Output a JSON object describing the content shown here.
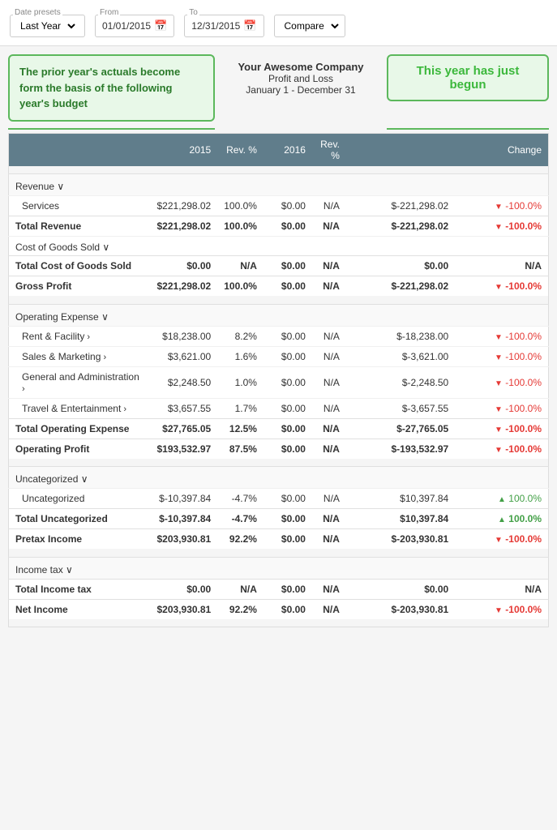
{
  "header": {
    "date_preset_label": "Date presets",
    "date_preset_value": "Last Year",
    "from_label": "From",
    "from_value": "01/01/2015",
    "to_label": "To",
    "to_value": "12/31/2015",
    "compare_label": "Compare"
  },
  "callout_left": "The prior year's actuals become form the basis of the following year's budget",
  "callout_right": "This year has just begun",
  "company": {
    "name": "Your Awesome Company",
    "report": "Profit and Loss",
    "date_range": "January 1 - December 31"
  },
  "columns": {
    "year1": "2015",
    "rev1": "Rev. %",
    "year2": "2016",
    "rev2": "Rev. %",
    "change": "Change"
  },
  "sections": {
    "revenue": {
      "label": "Revenue ∨",
      "rows": [
        {
          "name": "Services",
          "v2015": "$221,298.02",
          "rev1": "100.0%",
          "v2016": "$0.00",
          "rev2": "N/A",
          "change": "$-221,298.02",
          "arrow": "down",
          "chgpct": "-100.0%"
        }
      ],
      "total": {
        "name": "Total Revenue",
        "v2015": "$221,298.02",
        "rev1": "100.0%",
        "v2016": "$0.00",
        "rev2": "N/A",
        "change": "$-221,298.02",
        "arrow": "down",
        "chgpct": "-100.0%"
      }
    },
    "cogs": {
      "label": "Cost of Goods Sold ∨",
      "rows": [],
      "total": {
        "name": "Total Cost of Goods Sold",
        "v2015": "$0.00",
        "rev1": "N/A",
        "v2016": "$0.00",
        "rev2": "N/A",
        "change": "$0.00",
        "arrow": "",
        "chgpct": "N/A"
      }
    },
    "grossprofit": {
      "name": "Gross Profit",
      "v2015": "$221,298.02",
      "rev1": "100.0%",
      "v2016": "$0.00",
      "rev2": "N/A",
      "change": "$-221,298.02",
      "arrow": "down",
      "chgpct": "-100.0%"
    },
    "opex": {
      "label": "Operating Expense ∨",
      "rows": [
        {
          "name": "Rent & Facility",
          "expandable": true,
          "v2015": "$18,238.00",
          "rev1": "8.2%",
          "v2016": "$0.00",
          "rev2": "N/A",
          "change": "$-18,238.00",
          "arrow": "down",
          "chgpct": "-100.0%"
        },
        {
          "name": "Sales & Marketing",
          "expandable": true,
          "v2015": "$3,621.00",
          "rev1": "1.6%",
          "v2016": "$0.00",
          "rev2": "N/A",
          "change": "$-3,621.00",
          "arrow": "down",
          "chgpct": "-100.0%"
        },
        {
          "name": "General and Administration",
          "expandable": true,
          "v2015": "$2,248.50",
          "rev1": "1.0%",
          "v2016": "$0.00",
          "rev2": "N/A",
          "change": "$-2,248.50",
          "arrow": "down",
          "chgpct": "-100.0%"
        },
        {
          "name": "Travel & Entertainment",
          "expandable": true,
          "v2015": "$3,657.55",
          "rev1": "1.7%",
          "v2016": "$0.00",
          "rev2": "N/A",
          "change": "$-3,657.55",
          "arrow": "down",
          "chgpct": "-100.0%"
        }
      ],
      "total": {
        "name": "Total Operating Expense",
        "v2015": "$27,765.05",
        "rev1": "12.5%",
        "v2016": "$0.00",
        "rev2": "N/A",
        "change": "$-27,765.05",
        "arrow": "down",
        "chgpct": "-100.0%"
      },
      "profit": {
        "name": "Operating Profit",
        "v2015": "$193,532.97",
        "rev1": "87.5%",
        "v2016": "$0.00",
        "rev2": "N/A",
        "change": "$-193,532.97",
        "arrow": "down",
        "chgpct": "-100.0%"
      }
    },
    "uncategorized": {
      "label": "Uncategorized ∨",
      "rows": [
        {
          "name": "Uncategorized",
          "v2015": "$-10,397.84",
          "rev1": "-4.7%",
          "v2016": "$0.00",
          "rev2": "N/A",
          "change": "$10,397.84",
          "arrow": "up",
          "chgpct": "100.0%"
        }
      ],
      "total": {
        "name": "Total Uncategorized",
        "v2015": "$-10,397.84",
        "rev1": "-4.7%",
        "v2016": "$0.00",
        "rev2": "N/A",
        "change": "$10,397.84",
        "arrow": "up",
        "chgpct": "100.0%"
      },
      "pretax": {
        "name": "Pretax Income",
        "v2015": "$203,930.81",
        "rev1": "92.2%",
        "v2016": "$0.00",
        "rev2": "N/A",
        "change": "$-203,930.81",
        "arrow": "down",
        "chgpct": "-100.0%"
      }
    },
    "incometax": {
      "label": "Income tax ∨",
      "total": {
        "name": "Total Income tax",
        "v2015": "$0.00",
        "rev1": "N/A",
        "v2016": "$0.00",
        "rev2": "N/A",
        "change": "$0.00",
        "arrow": "",
        "chgpct": "N/A"
      },
      "netincome": {
        "name": "Net Income",
        "v2015": "$203,930.81",
        "rev1": "92.2%",
        "v2016": "$0.00",
        "rev2": "N/A",
        "change": "$-203,930.81",
        "arrow": "down",
        "chgpct": "-100.0%"
      }
    }
  }
}
